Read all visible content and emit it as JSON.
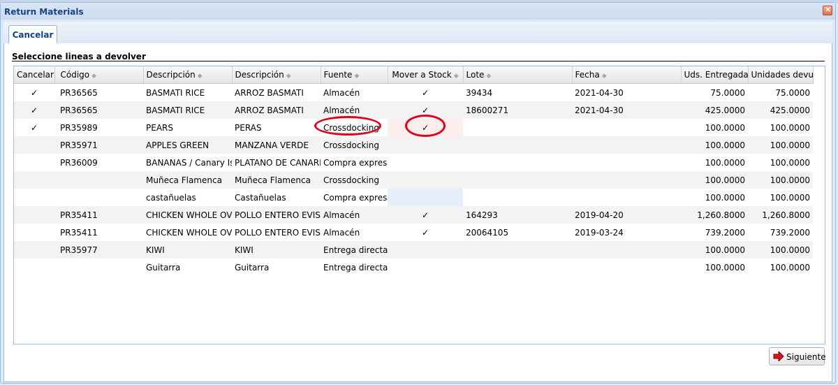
{
  "window": {
    "title": "Return Materials"
  },
  "tabs": [
    {
      "label": "Cancelar"
    }
  ],
  "section": {
    "title": "Seleccione lineas a devolver"
  },
  "grid": {
    "columns": [
      "Cancelar",
      "Código",
      "Descripción",
      "Descripción",
      "Fuente",
      "Mover a Stock",
      "Lote",
      "Fecha",
      "Uds. Entregadas",
      "Unidades devuel"
    ],
    "rows": [
      {
        "cancel": "✓",
        "code": "PR36565",
        "desc": "BASMATI RICE",
        "desc_es": "ARROZ BASMATI",
        "source": "Almacén",
        "stock": "✓",
        "lot": "39434",
        "date": "2021-04-30",
        "delivered": "75.0000",
        "returned": "75.0000"
      },
      {
        "cancel": "✓",
        "code": "PR36565",
        "desc": "BASMATI RICE",
        "desc_es": "ARROZ BASMATI",
        "source": "Almacén",
        "stock": "✓",
        "lot": "18600271",
        "date": "2021-04-30",
        "delivered": "425.0000",
        "returned": "425.0000"
      },
      {
        "cancel": "✓",
        "code": "PR35989",
        "desc": "PEARS",
        "desc_es": "PERAS",
        "source": "Crossdocking",
        "stock": "✓",
        "lot": "",
        "date": "",
        "delivered": "100.0000",
        "returned": "100.0000"
      },
      {
        "cancel": "",
        "code": "PR35971",
        "desc": "APPLES GREEN",
        "desc_es": "MANZANA VERDE",
        "source": "Crossdocking",
        "stock": "",
        "lot": "",
        "date": "",
        "delivered": "100.0000",
        "returned": "100.0000"
      },
      {
        "cancel": "",
        "code": "PR36009",
        "desc": "BANANAS / Canary Isla",
        "desc_es": "PLATANO DE CANARIA",
        "source": "Compra express",
        "stock": "",
        "lot": "",
        "date": "",
        "delivered": "100.0000",
        "returned": "100.0000"
      },
      {
        "cancel": "",
        "code": "",
        "desc": "Muñeca Flamenca",
        "desc_es": "Muñeca Flamenca",
        "source": "Crossdocking",
        "stock": "",
        "lot": "",
        "date": "",
        "delivered": "100.0000",
        "returned": "100.0000"
      },
      {
        "cancel": "",
        "code": "",
        "desc": "castañuelas",
        "desc_es": "Castañuelas",
        "source": "Compra express",
        "stock": "",
        "lot": "",
        "date": "",
        "delivered": "100.0000",
        "returned": "100.0000"
      },
      {
        "cancel": "",
        "code": "PR35411",
        "desc": "CHICKEN WHOLE OVEN",
        "desc_es": "POLLO ENTERO EVISCERADO",
        "source": "Almacén",
        "stock": "✓",
        "lot": "164293",
        "date": "2019-04-20",
        "delivered": "1,260.8000",
        "returned": "1,260.8000"
      },
      {
        "cancel": "",
        "code": "PR35411",
        "desc": "CHICKEN WHOLE OVEN",
        "desc_es": "POLLO ENTERO EVISCERADO",
        "source": "Almacén",
        "stock": "✓",
        "lot": "20064105",
        "date": "2019-03-24",
        "delivered": "739.2000",
        "returned": "739.2000"
      },
      {
        "cancel": "",
        "code": "PR35977",
        "desc": "KIWI",
        "desc_es": "KIWI",
        "source": "Entrega directa",
        "stock": "",
        "lot": "",
        "date": "",
        "delivered": "100.0000",
        "returned": "100.0000"
      },
      {
        "cancel": "",
        "code": "",
        "desc": "Guitarra",
        "desc_es": "Guitarra",
        "source": "Entrega directa",
        "stock": "",
        "lot": "",
        "date": "",
        "delivered": "100.0000",
        "returned": "100.0000"
      }
    ]
  },
  "footer": {
    "next_label": "Siguiente"
  },
  "colors": {
    "title": "#15428b",
    "highlight": "#e2001a",
    "border": "#99bbe8"
  },
  "icons": {
    "close": "close-icon",
    "sort": "sort-icon",
    "next": "arrow-right-icon",
    "check": "checkmark-icon"
  }
}
